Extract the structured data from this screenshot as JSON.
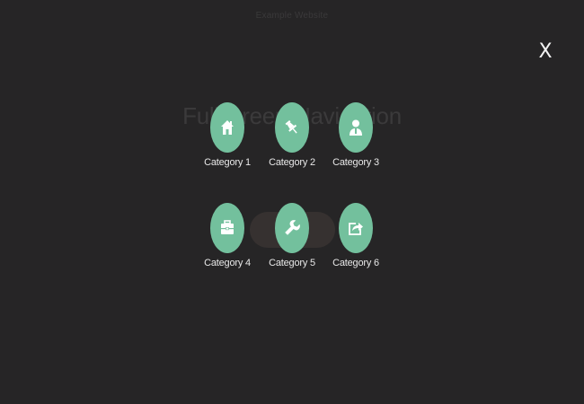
{
  "background": {
    "caption": "Example Website",
    "heading": "Fullscreen Navigation"
  },
  "overlay": {
    "close_label": "X",
    "categories": [
      {
        "label": "Category 1",
        "icon": "home-icon"
      },
      {
        "label": "Category 2",
        "icon": "pushpin-icon"
      },
      {
        "label": "Category 3",
        "icon": "user-icon"
      },
      {
        "label": "Category 4",
        "icon": "briefcase-icon"
      },
      {
        "label": "Category 5",
        "icon": "wrench-icon"
      },
      {
        "label": "Category 6",
        "icon": "share-icon"
      }
    ]
  },
  "colors": {
    "background": "#262526",
    "accent": "#73c09d",
    "label_text": "#e8e8e8"
  }
}
